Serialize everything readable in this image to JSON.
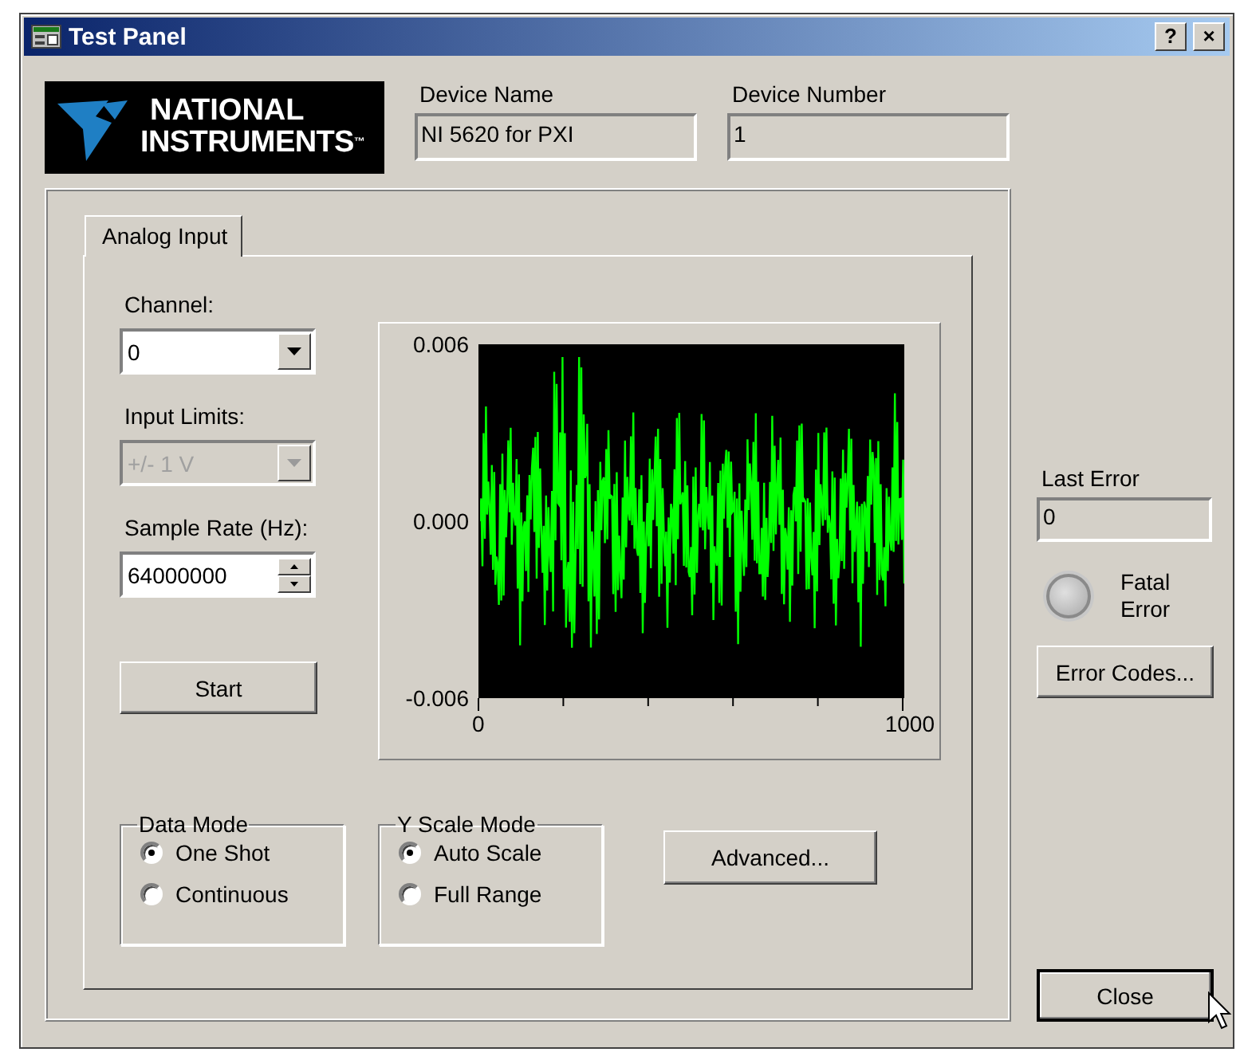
{
  "window": {
    "title": "Test Panel",
    "help_button": "?",
    "close_button": "×"
  },
  "logo": {
    "lines": [
      "NATIONAL",
      "INSTRUMENTS"
    ],
    "trademark": "™"
  },
  "device_name": {
    "label": "Device Name",
    "value": "NI 5620 for PXI"
  },
  "device_number": {
    "label": "Device Number",
    "value": "1"
  },
  "tabs": [
    {
      "label": "Analog Input",
      "selected": true
    }
  ],
  "channel": {
    "label": "Channel:",
    "value": "0",
    "disabled": false
  },
  "input_limits": {
    "label": "Input Limits:",
    "value": "+/- 1 V",
    "disabled": true
  },
  "sample_rate": {
    "label": "Sample Rate (Hz):",
    "value": "64000000"
  },
  "start_button": "Start",
  "graph": {
    "y_ticks": [
      "0.006",
      "0.000",
      "-0.006"
    ],
    "x_ticks": [
      "0",
      "1000"
    ]
  },
  "data_mode": {
    "title": "Data Mode",
    "options": [
      {
        "label": "One Shot",
        "selected": true
      },
      {
        "label": "Continuous",
        "selected": false
      }
    ]
  },
  "y_scale_mode": {
    "title": "Y Scale Mode",
    "options": [
      {
        "label": "Auto Scale",
        "selected": true
      },
      {
        "label": "Full Range",
        "selected": false
      }
    ]
  },
  "advanced_button": "Advanced...",
  "last_error": {
    "label": "Last Error",
    "value": "0"
  },
  "fatal_error": {
    "label": "Fatal Error",
    "on": false
  },
  "error_codes_button": "Error Codes...",
  "close_button": "Close"
}
